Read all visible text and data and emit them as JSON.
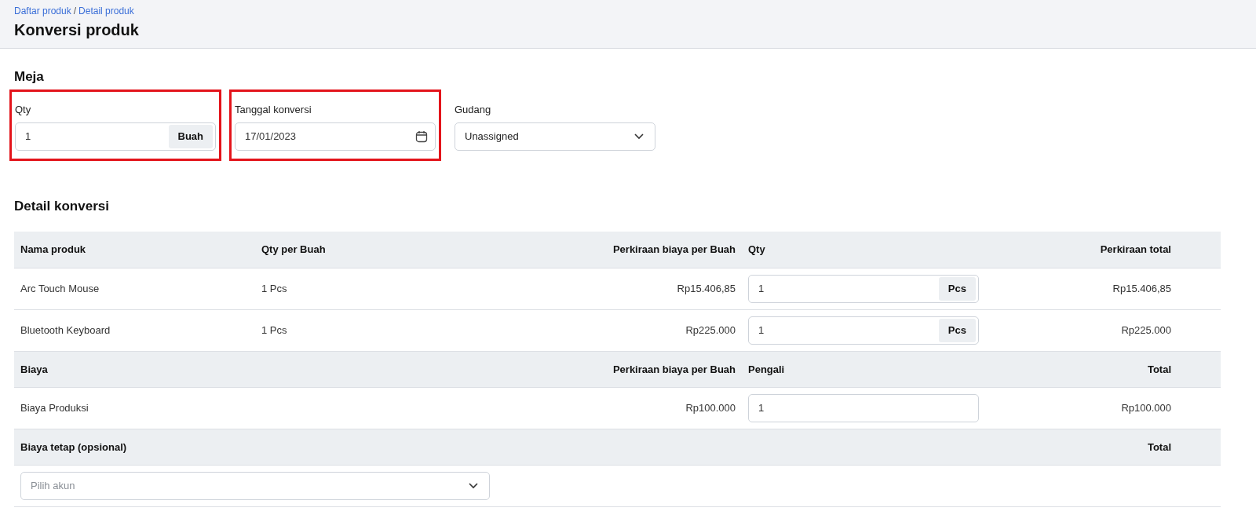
{
  "breadcrumb": [
    {
      "label": "Daftar produk"
    },
    {
      "label": "Detail produk"
    }
  ],
  "breadcrumb_separator": "/",
  "title": "Konversi produk",
  "meja": {
    "title": "Meja",
    "fields": [
      {
        "kind": "unit-input",
        "label": "Qty",
        "value": "1",
        "unit": "Buah",
        "highlighted": true
      },
      {
        "kind": "date",
        "label": "Tanggal konversi",
        "value": "17/01/2023",
        "highlighted": true
      },
      {
        "kind": "select",
        "label": "Gudang",
        "value": "Unassigned",
        "highlighted": false
      }
    ]
  },
  "detail": {
    "title": "Detail konversi",
    "products": {
      "columns": [
        "Nama produk",
        "Qty per Buah",
        "Perkiraan biaya per Buah",
        "Qty",
        "Perkiraan total"
      ],
      "rows": [
        {
          "name": "Arc Touch Mouse",
          "qty_per": "1 Pcs",
          "cost": "Rp15.406,85",
          "qty": "1",
          "unit": "Pcs",
          "total": "Rp15.406,85"
        },
        {
          "name": "Bluetooth Keyboard",
          "qty_per": "1 Pcs",
          "cost": "Rp225.000",
          "qty": "1",
          "unit": "Pcs",
          "total": "Rp225.000"
        }
      ]
    },
    "costs": {
      "columns": [
        "Biaya",
        "Perkiraan biaya per Buah",
        "Pengali",
        "Total"
      ],
      "rows": [
        {
          "name": "Biaya Produksi",
          "cost": "Rp100.000",
          "multiplier": "1",
          "total": "Rp100.000"
        }
      ]
    },
    "fixed_costs": {
      "columns": [
        "Biaya tetap (opsional)",
        "Total"
      ],
      "select": {
        "placeholder": "Pilih akun"
      }
    }
  }
}
